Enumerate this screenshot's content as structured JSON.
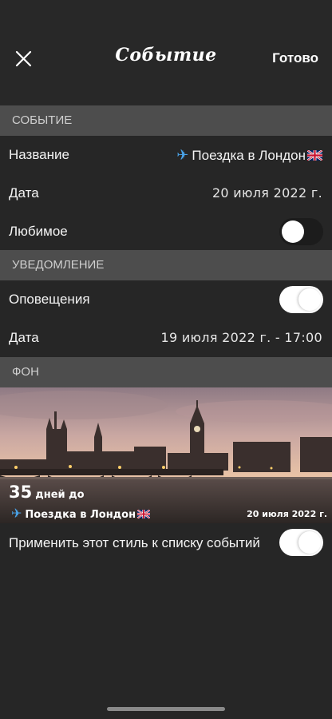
{
  "header": {
    "title": "Событие",
    "done_label": "Готово"
  },
  "sections": {
    "event": "СОБЫТИЕ",
    "notification": "УВЕДОМЛЕНИЕ",
    "background": "ФОН"
  },
  "event": {
    "name_label": "Название",
    "name_value": "Поездка в Лондон",
    "date_label": "Дата",
    "date_value": "20 июля 2022 г.",
    "favorite_label": "Любимое",
    "favorite_on": false
  },
  "notification": {
    "alerts_label": "Оповещения",
    "alerts_on": true,
    "date_label": "Дата",
    "date_value": "19 июля 2022 г. - 17:00"
  },
  "preview": {
    "days_count": "35",
    "days_text": "дней до",
    "event_name": "Поездка в Лондон",
    "event_date": "20 июля 2022 г."
  },
  "apply_style": {
    "label": "Применить этот стиль к списку событий",
    "on": true
  },
  "icons": {
    "close": "close-icon",
    "event": "airplane-icon",
    "flag": "uk-flag-icon"
  },
  "colors": {
    "background": "#262626",
    "section_header": "#4d4d4d",
    "plane": "#4aa3e8"
  }
}
